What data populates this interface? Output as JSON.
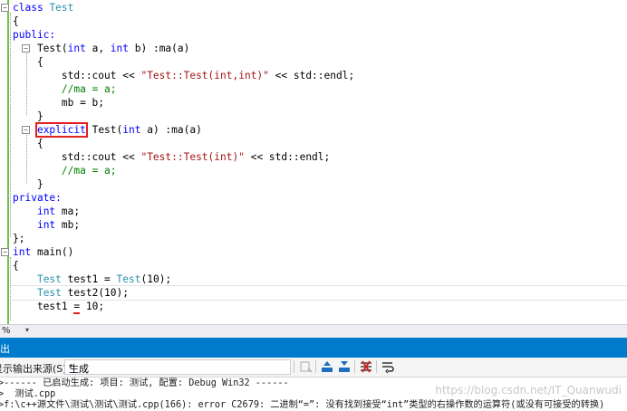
{
  "editor": {
    "lines": [
      [
        {
          "t": "class ",
          "c": "kw"
        },
        {
          "t": "Test",
          "c": "ty"
        }
      ],
      [
        {
          "t": "{"
        }
      ],
      [
        {
          "t": "public:",
          "c": "kw"
        }
      ],
      [
        {
          "t": "    Test("
        },
        {
          "t": "int",
          "c": "kw"
        },
        {
          "t": " a, "
        },
        {
          "t": "int",
          "c": "kw"
        },
        {
          "t": " b) :ma(a)"
        }
      ],
      [
        {
          "t": "    {"
        }
      ],
      [
        {
          "t": "        std::cout << "
        },
        {
          "t": "\"Test::Test(int,int)\"",
          "c": "str"
        },
        {
          "t": " << std::endl;"
        }
      ],
      [
        {
          "t": "        "
        },
        {
          "t": "//ma = a;",
          "c": "cm"
        }
      ],
      [
        {
          "t": "        mb = b;"
        }
      ],
      [
        {
          "t": "    }"
        }
      ],
      [
        {
          "t": "    "
        },
        {
          "t": "explicit",
          "c": "kw",
          "box": true
        },
        {
          "t": " Test("
        },
        {
          "t": "int",
          "c": "kw"
        },
        {
          "t": " a) :ma(a)"
        }
      ],
      [
        {
          "t": "    {"
        }
      ],
      [
        {
          "t": "        std::cout << "
        },
        {
          "t": "\"Test::Test(int)\"",
          "c": "str"
        },
        {
          "t": " << std::endl;"
        }
      ],
      [
        {
          "t": "        "
        },
        {
          "t": "//ma = a;",
          "c": "cm"
        }
      ],
      [
        {
          "t": "    }"
        }
      ],
      [
        {
          "t": "private:",
          "c": "kw"
        }
      ],
      [
        {
          "t": "    "
        },
        {
          "t": "int",
          "c": "kw"
        },
        {
          "t": " ma;"
        }
      ],
      [
        {
          "t": "    "
        },
        {
          "t": "int",
          "c": "kw"
        },
        {
          "t": " mb;"
        }
      ],
      [
        {
          "t": "};"
        }
      ],
      [
        {
          "t": "int",
          "c": "kw"
        },
        {
          "t": " main()"
        }
      ],
      [
        {
          "t": "{"
        }
      ],
      [
        {
          "t": "    "
        },
        {
          "t": "Test",
          "c": "ty"
        },
        {
          "t": " test1 = "
        },
        {
          "t": "Test",
          "c": "ty"
        },
        {
          "t": "(10);"
        }
      ],
      [
        {
          "t": "    "
        },
        {
          "t": "Test",
          "c": "ty"
        },
        {
          "t": " test2(10);"
        }
      ],
      [
        {
          "t": "    test1 "
        },
        {
          "t": "=",
          "sq": true
        },
        {
          "t": " 10;"
        }
      ]
    ]
  },
  "status": {
    "zoom": "%",
    "zoom_arrow": "▾"
  },
  "output": {
    "title": "出",
    "source_label": "显示输出来源(S):",
    "source_value": "生成",
    "source_dropdown": "▾",
    "lines": [
      ">------ 已启动生成: 项目: 测试, 配置: Debug Win32 ------",
      ">  测试.cpp",
      ">f:\\c++源文件\\测试\\测试\\测试.cpp(166): error C2679: 二进制“=”: 没有找到接受“int”类型的右操作数的运算符(或没有可接受的转换)"
    ],
    "toolbar_icons": [
      "find-message-icon",
      "prev-message-icon",
      "next-message-icon",
      "clear-all-icon",
      "word-wrap-icon"
    ]
  },
  "watermark": "https://blog.csdn.net/IT_Quanwudi",
  "colors": {
    "keyword": "#0000ff",
    "type": "#2b91af",
    "string": "#a31515",
    "comment": "#008000",
    "accent": "#007acc",
    "change_bar": "#6fbf4d",
    "error": "#e02020"
  }
}
